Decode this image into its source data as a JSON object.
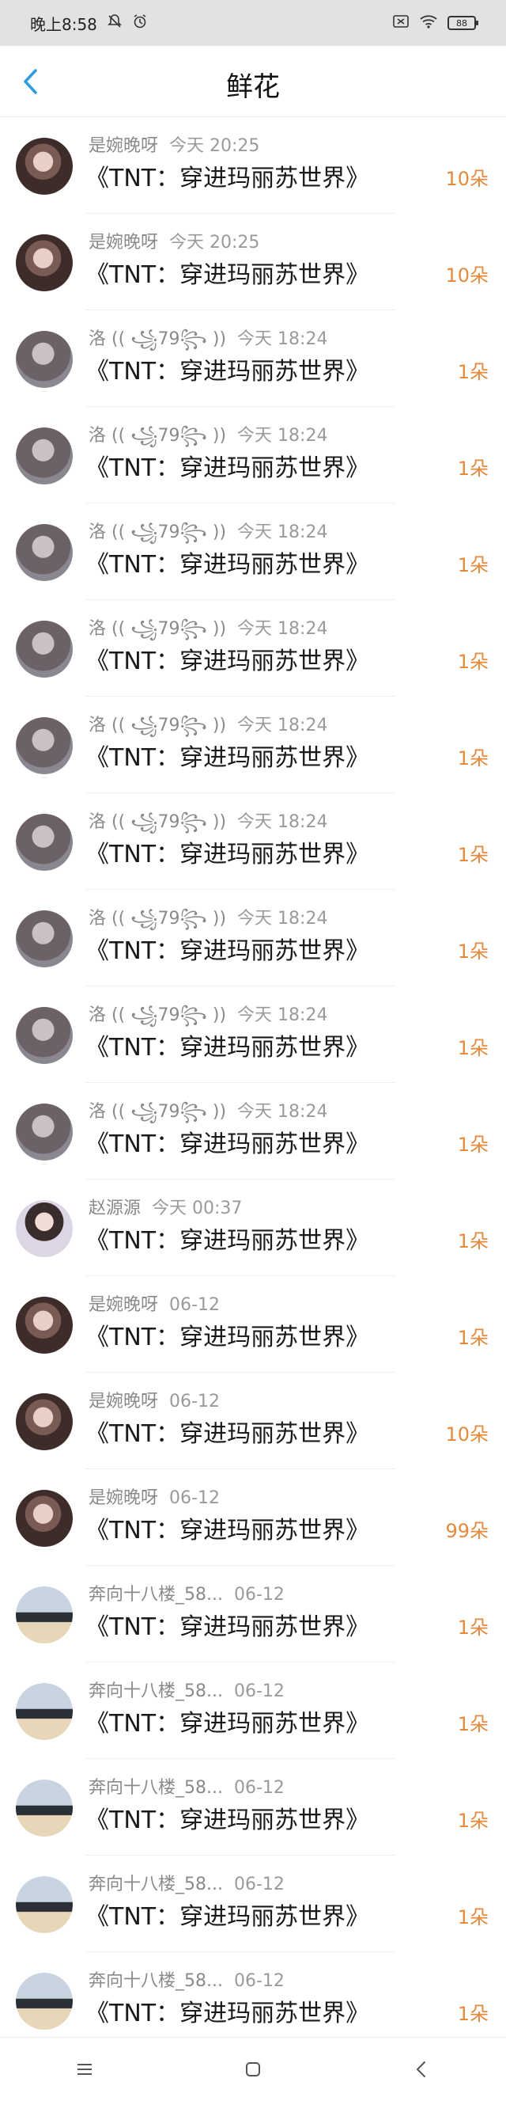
{
  "status_bar": {
    "time": "晚上8:58",
    "left_icons": [
      "bell-off-icon",
      "alarm-icon"
    ],
    "right_icons": [
      "no-sim-icon",
      "wifi-icon"
    ],
    "battery": "88"
  },
  "header": {
    "title": "鲜花",
    "back_icon": "chevron-left-icon"
  },
  "list": [
    {
      "user": "是婉晚呀",
      "time": "今天 20:25",
      "book": "《TNT：穿进玛丽苏世界》",
      "count": "10朵",
      "avatar": "a1"
    },
    {
      "user": "是婉晚呀",
      "time": "今天 20:25",
      "book": "《TNT：穿进玛丽苏世界》",
      "count": "10朵",
      "avatar": "a1"
    },
    {
      "user": "洛 (( ꧁79꧂ ))",
      "time": "今天 18:24",
      "book": "《TNT：穿进玛丽苏世界》",
      "count": "1朵",
      "avatar": "a2"
    },
    {
      "user": "洛 (( ꧁79꧂ ))",
      "time": "今天 18:24",
      "book": "《TNT：穿进玛丽苏世界》",
      "count": "1朵",
      "avatar": "a2"
    },
    {
      "user": "洛 (( ꧁79꧂ ))",
      "time": "今天 18:24",
      "book": "《TNT：穿进玛丽苏世界》",
      "count": "1朵",
      "avatar": "a2"
    },
    {
      "user": "洛 (( ꧁79꧂ ))",
      "time": "今天 18:24",
      "book": "《TNT：穿进玛丽苏世界》",
      "count": "1朵",
      "avatar": "a2"
    },
    {
      "user": "洛 (( ꧁79꧂ ))",
      "time": "今天 18:24",
      "book": "《TNT：穿进玛丽苏世界》",
      "count": "1朵",
      "avatar": "a2"
    },
    {
      "user": "洛 (( ꧁79꧂ ))",
      "time": "今天 18:24",
      "book": "《TNT：穿进玛丽苏世界》",
      "count": "1朵",
      "avatar": "a2"
    },
    {
      "user": "洛 (( ꧁79꧂ ))",
      "time": "今天 18:24",
      "book": "《TNT：穿进玛丽苏世界》",
      "count": "1朵",
      "avatar": "a2"
    },
    {
      "user": "洛 (( ꧁79꧂ ))",
      "time": "今天 18:24",
      "book": "《TNT：穿进玛丽苏世界》",
      "count": "1朵",
      "avatar": "a2"
    },
    {
      "user": "洛 (( ꧁79꧂ ))",
      "time": "今天 18:24",
      "book": "《TNT：穿进玛丽苏世界》",
      "count": "1朵",
      "avatar": "a2"
    },
    {
      "user": "赵源源",
      "time": "今天 00:37",
      "book": "《TNT：穿进玛丽苏世界》",
      "count": "1朵",
      "avatar": "a3"
    },
    {
      "user": "是婉晚呀",
      "time": "06-12",
      "book": "《TNT：穿进玛丽苏世界》",
      "count": "1朵",
      "avatar": "a1"
    },
    {
      "user": "是婉晚呀",
      "time": "06-12",
      "book": "《TNT：穿进玛丽苏世界》",
      "count": "10朵",
      "avatar": "a1"
    },
    {
      "user": "是婉晚呀",
      "time": "06-12",
      "book": "《TNT：穿进玛丽苏世界》",
      "count": "99朵",
      "avatar": "a1"
    },
    {
      "user": "奔向十八楼_58...",
      "time": "06-12",
      "book": "《TNT：穿进玛丽苏世界》",
      "count": "1朵",
      "avatar": "a4"
    },
    {
      "user": "奔向十八楼_58...",
      "time": "06-12",
      "book": "《TNT：穿进玛丽苏世界》",
      "count": "1朵",
      "avatar": "a4"
    },
    {
      "user": "奔向十八楼_58...",
      "time": "06-12",
      "book": "《TNT：穿进玛丽苏世界》",
      "count": "1朵",
      "avatar": "a4"
    },
    {
      "user": "奔向十八楼_58...",
      "time": "06-12",
      "book": "《TNT：穿进玛丽苏世界》",
      "count": "1朵",
      "avatar": "a4"
    },
    {
      "user": "奔向十八楼_58...",
      "time": "06-12",
      "book": "《TNT：穿进玛丽苏世界》",
      "count": "1朵",
      "avatar": "a4"
    }
  ],
  "nav_bar": {
    "icons": [
      "menu-icon",
      "home-square-icon",
      "back-triangle-icon"
    ]
  },
  "colors": {
    "accent_blue": "#2f9be0",
    "count_orange": "#e48a3c",
    "status_bar_bg": "#e2e2e2"
  }
}
